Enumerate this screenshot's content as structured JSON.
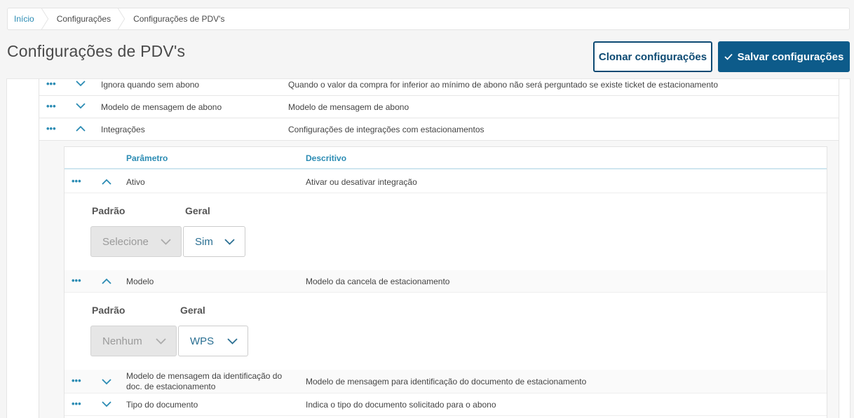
{
  "breadcrumb": [
    "Início",
    "Configurações",
    "Configurações de PDV's"
  ],
  "page_title": "Configurações de PDV's",
  "buttons": {
    "clone": "Clonar configurações",
    "save": "Salvar configurações"
  },
  "outer_rows": [
    {
      "name": "Ignora quando sem abono",
      "desc": "Quando o valor da compra for inferior ao mínimo de abono não será perguntado se existe ticket de estacionamento",
      "expanded": false
    },
    {
      "name": "Modelo de mensagem de abono",
      "desc": "Modelo de mensagem de abono",
      "expanded": false
    },
    {
      "name": "Integrações",
      "desc": "Configurações de integrações com estacionamentos",
      "expanded": true
    }
  ],
  "inner": {
    "header": {
      "param": "Parâmetro",
      "desc": "Descritivo"
    },
    "rows": [
      {
        "name": "Ativo",
        "desc": "Ativar ou desativar integração"
      },
      {
        "name": "Modelo",
        "desc": "Modelo da cancela de estacionamento"
      },
      {
        "name": "Modelo de mensagem da identificação do doc. de estacionamento",
        "desc": "Modelo de mensagem para identificação do documento de estacionamento"
      },
      {
        "name": "Tipo do documento",
        "desc": "Indica o tipo do documento solicitado para o abono"
      }
    ],
    "details": [
      {
        "label_default": "Padrão",
        "label_general": "Geral",
        "default_value": "Selecione",
        "general_value": "Sim"
      },
      {
        "label_default": "Padrão",
        "label_general": "Geral",
        "default_value": "Nenhum",
        "general_value": "WPS"
      }
    ]
  },
  "icons": {
    "dots": "more-dots-icon",
    "chevron": "chevron-icon",
    "check": "check-icon"
  },
  "colors": {
    "accent": "#2a8bb3",
    "primary": "#0d5b8a"
  }
}
